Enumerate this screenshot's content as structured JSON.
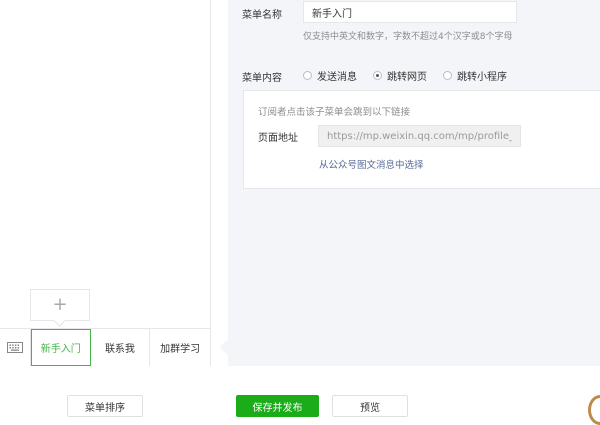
{
  "editor": {
    "name_label": "菜单名称",
    "name_value": "新手入门",
    "name_hint": "仅支持中英文和数字，字数不超过4个汉字或8个字母",
    "content_label": "菜单内容",
    "content_options": [
      {
        "label": "发送消息",
        "checked": false
      },
      {
        "label": "跳转网页",
        "checked": true
      },
      {
        "label": "跳转小程序",
        "checked": false
      }
    ],
    "box_hint": "订阅者点击该子菜单会跳到以下链接",
    "url_label": "页面地址",
    "url_value": "https://mp.weixin.qq.com/mp/profile_ext",
    "pick_link": "从公众号图文消息中选择"
  },
  "phone": {
    "add_sub_symbol": "+",
    "menu_items": [
      {
        "label": "新手入门",
        "active": true
      },
      {
        "label": "联系我",
        "active": false
      },
      {
        "label": "加群学习",
        "active": false
      }
    ]
  },
  "footer": {
    "sort_label": "菜单排序",
    "save_label": "保存并发布",
    "preview_label": "预览"
  },
  "colors": {
    "accent_green": "#44b549",
    "primary_button": "#1aad19",
    "link_blue": "#576b95",
    "panel_bg": "#f4f5f9"
  },
  "icons": {
    "keyboard": "keyboard-icon",
    "add": "plus-icon"
  }
}
